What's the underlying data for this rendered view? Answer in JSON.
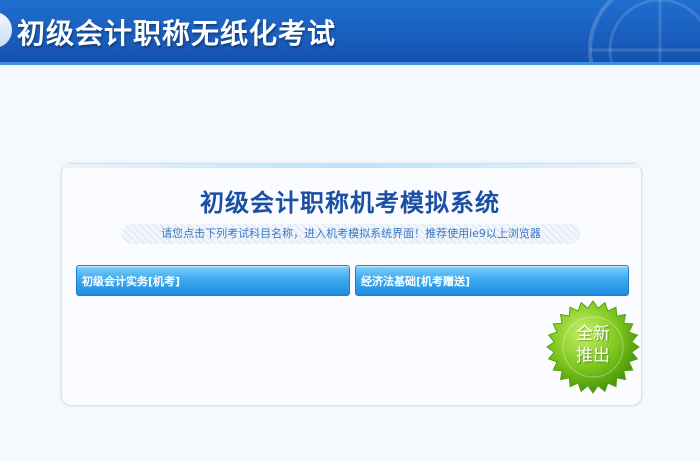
{
  "header": {
    "title": "初级会计职称无纸化考试"
  },
  "main": {
    "system_title": "初级会计职称机考模拟系统",
    "instruction": "请您点击下列考试科目名称，进入机考模拟系统界面！推荐使用ie9以上浏览器",
    "subjects": [
      {
        "label": "初级会计实务[机考]"
      },
      {
        "label": "经济法基础[机考赠送]"
      }
    ],
    "badge": {
      "line1": "全新",
      "line2": "推出"
    }
  },
  "colors": {
    "header_bg": "#1a5fbf",
    "title_blue": "#1b4fa3",
    "button_blue": "#3eaaf0",
    "badge_green": "#6cbf1a"
  }
}
